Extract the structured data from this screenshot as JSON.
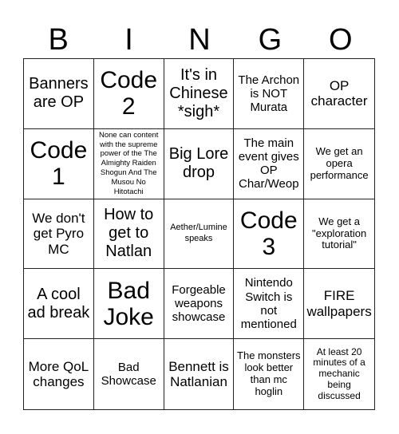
{
  "header": {
    "letters": [
      "B",
      "I",
      "N",
      "G",
      "O"
    ]
  },
  "cells": [
    "Banners are OP",
    "Code 2",
    "It's in Chinese *sigh*",
    "The Archon is NOT Murata",
    "OP character",
    "Code 1",
    "None can content with the supreme power of the The Almighty Raiden Shogun And The Musou No Hitotachi",
    "Big Lore drop",
    "The main event gives OP Char/Weop",
    "We get an opera performance",
    "We don't get Pyro MC",
    "How to get to Natlan",
    "Aether/Lumine speaks",
    "Code 3",
    "We get a \"exploration tutorial\"",
    "A cool ad break",
    "Bad Joke",
    "Forgeable weapons showcase",
    "Nintendo Switch is not mentioned",
    "FIRE wallpapers",
    "More QoL changes",
    "Bad Showcase",
    "Bennett is Natlanian",
    "The monsters look better than mc hoglin",
    "At least 20 minutes of a mechanic being discussed"
  ]
}
